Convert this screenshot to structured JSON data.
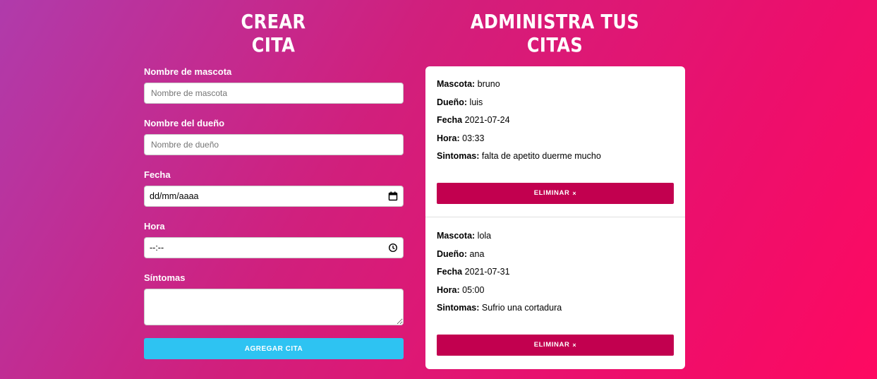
{
  "headings": {
    "create": "Crear Cita",
    "manage": "Administra tus citas"
  },
  "form": {
    "pet_label": "Nombre de mascota",
    "pet_placeholder": "Nombre de mascota",
    "owner_label": "Nombre del dueño",
    "owner_placeholder": "Nombre de dueño",
    "date_label": "Fecha",
    "date_value": "dd/mm/aaaa",
    "time_label": "Hora",
    "time_value": "--:--",
    "symptoms_label": "Síntomas",
    "symptoms_value": "",
    "submit_label": "Agregar Cita"
  },
  "labels": {
    "pet": "Mascota:",
    "owner": "Dueño:",
    "date": "Fecha",
    "time": "Hora:",
    "symptoms": "Sintomas:",
    "delete": "ELIMINAR",
    "delete_icon": "×"
  },
  "citas": [
    {
      "mascota": "bruno",
      "dueno": "luis",
      "fecha": "2021-07-24",
      "hora": "03:33",
      "sintomas": "falta de apetito duerme mucho"
    },
    {
      "mascota": "lola",
      "dueno": "ana",
      "fecha": "2021-07-31",
      "hora": "05:00",
      "sintomas": "Sufrio una cortadura"
    }
  ],
  "colors": {
    "submit": "#2ec3f2",
    "delete": "#c2004f",
    "gradient_start": "#b03bab",
    "gradient_end": "#fe0961"
  }
}
